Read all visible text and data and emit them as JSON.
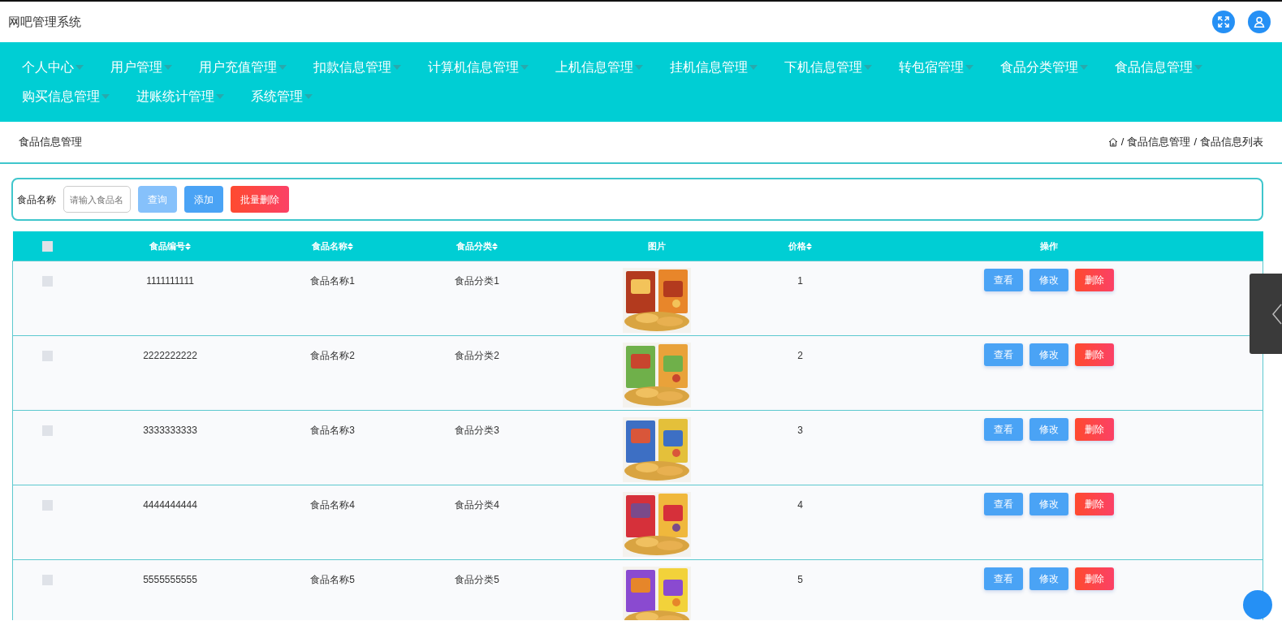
{
  "app": {
    "title": "网吧管理系统"
  },
  "nav": [
    {
      "label": "个人中心"
    },
    {
      "label": "用户管理"
    },
    {
      "label": "用户充值管理"
    },
    {
      "label": "扣款信息管理"
    },
    {
      "label": "计算机信息管理"
    },
    {
      "label": "上机信息管理"
    },
    {
      "label": "挂机信息管理"
    },
    {
      "label": "下机信息管理"
    },
    {
      "label": "转包宿管理"
    },
    {
      "label": "食品分类管理"
    },
    {
      "label": "食品信息管理"
    },
    {
      "label": "购买信息管理"
    },
    {
      "label": "进账统计管理"
    },
    {
      "label": "系统管理"
    }
  ],
  "page_title": "食品信息管理",
  "breadcrumb": [
    "食品信息管理",
    "食品信息列表"
  ],
  "breadcrumb_separator": "/",
  "search": {
    "label": "食品名称",
    "placeholder": "请输入食品名",
    "buttons": [
      {
        "label": "查询",
        "kind": "query"
      },
      {
        "label": "添加",
        "kind": "add"
      },
      {
        "label": "批量删除",
        "kind": "batch-delete"
      }
    ]
  },
  "table": {
    "header_checked": false,
    "columns": [
      {
        "label": "食品编号",
        "sortable": true
      },
      {
        "label": "食品名称",
        "sortable": true
      },
      {
        "label": "食品分类",
        "sortable": true
      },
      {
        "label": "图片",
        "sortable": false
      },
      {
        "label": "价格",
        "sortable": true
      },
      {
        "label": "操作",
        "sortable": false
      }
    ],
    "rows": [
      {
        "checked": false,
        "code": "1111111111",
        "name": "食品名称1",
        "category": "食品分类1",
        "price": "1",
        "actions": [
          {
            "label": "查看",
            "kind": "view"
          },
          {
            "label": "修改",
            "kind": "edit"
          },
          {
            "label": "删除",
            "kind": "delete"
          }
        ]
      },
      {
        "checked": false,
        "code": "2222222222",
        "name": "食品名称2",
        "category": "食品分类2",
        "price": "2",
        "actions": [
          {
            "label": "查看",
            "kind": "view"
          },
          {
            "label": "修改",
            "kind": "edit"
          },
          {
            "label": "删除",
            "kind": "delete"
          }
        ]
      },
      {
        "checked": false,
        "code": "3333333333",
        "name": "食品名称3",
        "category": "食品分类3",
        "price": "3",
        "actions": [
          {
            "label": "查看",
            "kind": "view"
          },
          {
            "label": "修改",
            "kind": "edit"
          },
          {
            "label": "删除",
            "kind": "delete"
          }
        ]
      },
      {
        "checked": false,
        "code": "4444444444",
        "name": "食品名称4",
        "category": "食品分类4",
        "price": "4",
        "actions": [
          {
            "label": "查看",
            "kind": "view"
          },
          {
            "label": "修改",
            "kind": "edit"
          },
          {
            "label": "删除",
            "kind": "delete"
          }
        ]
      },
      {
        "checked": false,
        "code": "5555555555",
        "name": "食品名称5",
        "category": "食品分类5",
        "price": "5",
        "actions": [
          {
            "label": "查看",
            "kind": "view"
          },
          {
            "label": "修改",
            "kind": "edit"
          },
          {
            "label": "删除",
            "kind": "delete"
          }
        ]
      }
    ]
  }
}
